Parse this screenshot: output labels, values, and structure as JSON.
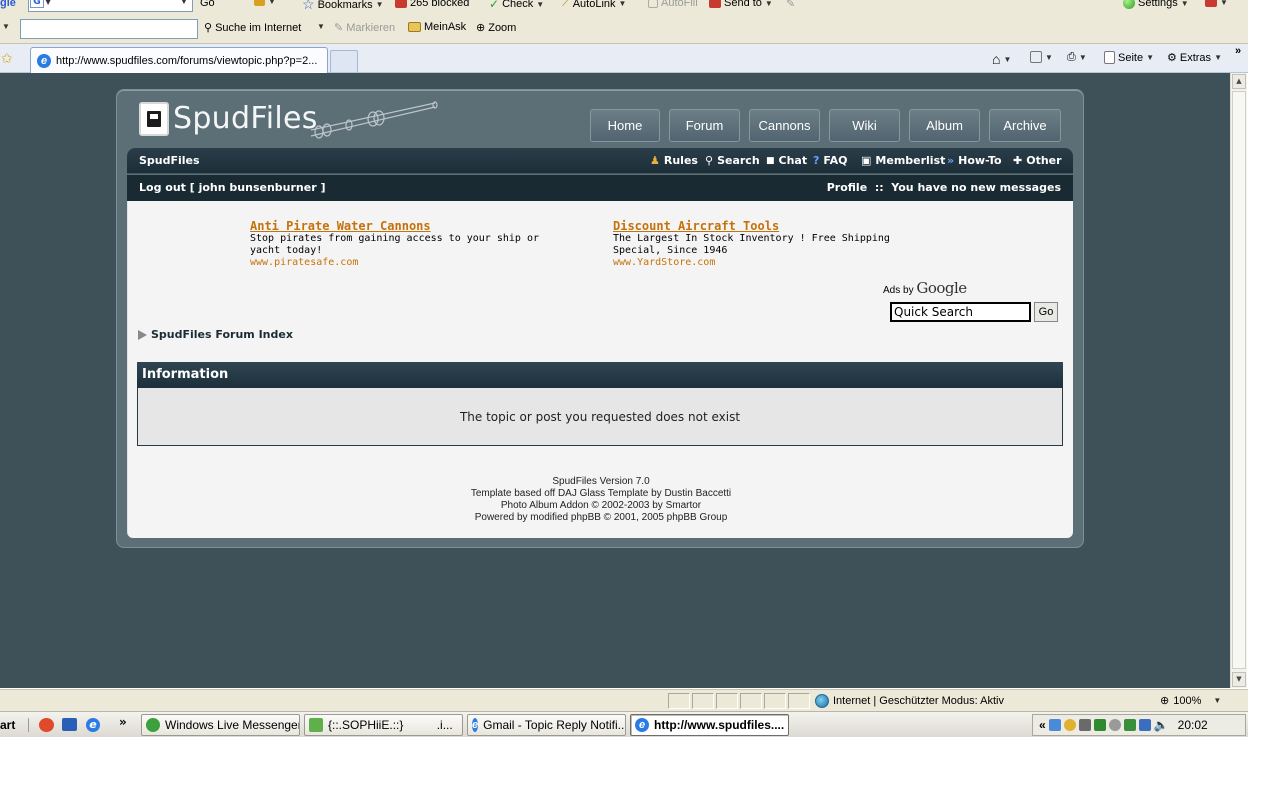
{
  "browser": {
    "toolbar1": {
      "go_label": "Go",
      "bookmarks_label": "Bookmarks",
      "blocked_label": "265 blocked",
      "check_label": "Check",
      "autolink_label": "AutoLink",
      "autofill_label": "AutoFill",
      "sendto_label": "Send to",
      "settings_label": "Settings"
    },
    "toolbar2": {
      "search_label": "Suche im Internet",
      "markieren_label": "Markieren",
      "meinask_label": "MeinAsk",
      "zoom_label": "Zoom"
    },
    "tab": {
      "url": "http://www.spudfiles.com/forums/viewtopic.php?p=2...",
      "seite_label": "Seite",
      "extras_label": "Extras"
    }
  },
  "site": {
    "logo_text": "SpudFiles",
    "nav": [
      "Home",
      "Forum",
      "Cannons",
      "Wiki",
      "Album",
      "Archive"
    ],
    "bar1": {
      "site_name": "SpudFiles",
      "links": [
        "Rules",
        "Search",
        "Chat",
        "FAQ",
        "Memberlist",
        "How-To",
        "Other"
      ]
    },
    "bar2": {
      "logout": "Log out [ john bunsenburner ]",
      "profile": "Profile  ::  You have no new messages"
    },
    "ads": [
      {
        "title": "Anti Pirate Water Cannons",
        "text": "Stop pirates from gaining access to your ship or yacht today!",
        "url": "www.piratesafe.com"
      },
      {
        "title": "Discount Aircraft Tools",
        "text": "The Largest In Stock Inventory ! Free Shipping Special, Since 1946",
        "url": "www.YardStore.com"
      }
    ],
    "ads_by": "Ads by",
    "ads_by_brand": "Google",
    "quick_search_value": "Quick Search",
    "go_button": "Go",
    "breadcrumb": "SpudFiles Forum Index",
    "info_title": "Information",
    "info_message": "The topic or post you requested does not exist",
    "footer": [
      "SpudFiles Version 7.0",
      "Template based off DAJ Glass Template by Dustin Baccetti",
      "Photo Album Addon © 2002-2003 by Smartor",
      "Powered by modified phpBB © 2001, 2005 phpBB Group"
    ]
  },
  "statusbar": {
    "zone": "Internet | Geschützter Modus: Aktiv",
    "zoom": "100%"
  },
  "taskbar": {
    "start": "art",
    "tasks": [
      "Windows Live Messenger",
      "{::.SOPHiiE.::}          .i...",
      "Gmail - Topic Reply Notifi...",
      "http://www.spudfiles...."
    ],
    "clock": "20:02"
  }
}
